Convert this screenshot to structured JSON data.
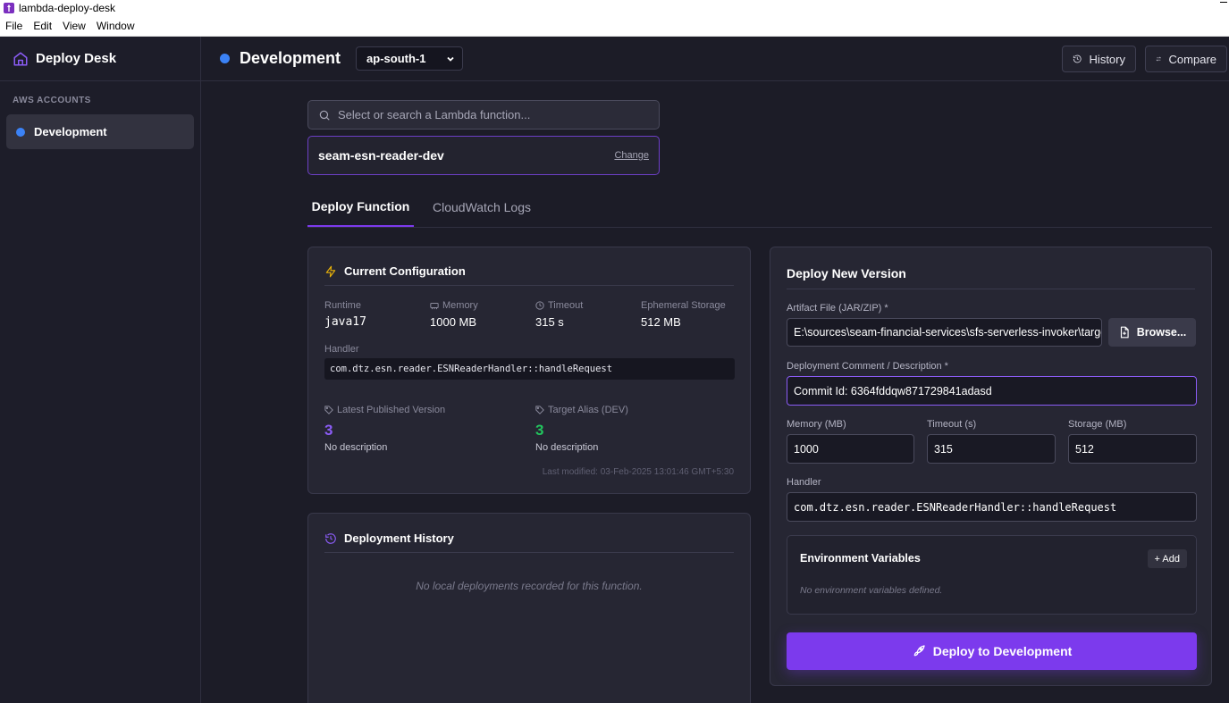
{
  "window": {
    "title": "lambda-deploy-desk",
    "menu": [
      "File",
      "Edit",
      "View",
      "Window"
    ]
  },
  "sidebar": {
    "brand": "Deploy Desk",
    "section_label": "AWS ACCOUNTS",
    "items": [
      {
        "label": "Development",
        "color": "#3b82f6"
      }
    ]
  },
  "header": {
    "env_title": "Development",
    "region": "ap-south-1",
    "history_label": "History",
    "compare_label": "Compare"
  },
  "search": {
    "placeholder": "Select or search a Lambda function..."
  },
  "selected_function": {
    "name": "seam-esn-reader-dev",
    "change_label": "Change"
  },
  "tabs": [
    {
      "label": "Deploy Function",
      "active": true
    },
    {
      "label": "CloudWatch Logs",
      "active": false
    }
  ],
  "current_config": {
    "title": "Current Configuration",
    "runtime_label": "Runtime",
    "runtime": "java17",
    "memory_label": "Memory",
    "memory": "1000 MB",
    "timeout_label": "Timeout",
    "timeout": "315 s",
    "storage_label": "Ephemeral Storage",
    "storage": "512 MB",
    "handler_label": "Handler",
    "handler": "com.dtz.esn.reader.ESNReaderHandler::handleRequest",
    "latest_label": "Latest Published Version",
    "latest_version": "3",
    "latest_desc": "No description",
    "alias_label": "Target Alias (DEV)",
    "alias_version": "3",
    "alias_desc": "No description",
    "last_modified": "Last modified: 03-Feb-2025 13:01:46 GMT+5:30"
  },
  "history": {
    "title": "Deployment History",
    "empty": "No local deployments recorded for this function."
  },
  "deploy": {
    "title": "Deploy New Version",
    "artifact_label": "Artifact File (JAR/ZIP) *",
    "artifact_value": "E:\\sources\\seam-financial-services\\sfs-serverless-invoker\\targe",
    "browse_label": "Browse...",
    "comment_label": "Deployment Comment / Description *",
    "comment_value": "Commit Id: 6364fddqw871729841adasd",
    "memory_label": "Memory (MB)",
    "memory_value": "1000",
    "timeout_label": "Timeout (s)",
    "timeout_value": "315",
    "storage_label": "Storage (MB)",
    "storage_value": "512",
    "handler_label": "Handler",
    "handler_value": "com.dtz.esn.reader.ESNReaderHandler::handleRequest",
    "env_title": "Environment Variables",
    "env_add": "+ Add",
    "env_empty": "No environment variables defined.",
    "button_label": "Deploy to Development"
  },
  "colors": {
    "accent": "#7c3aed",
    "latest_version": "#8b5cf6",
    "alias_version": "#22c55e",
    "env_dot": "#3b82f6"
  }
}
